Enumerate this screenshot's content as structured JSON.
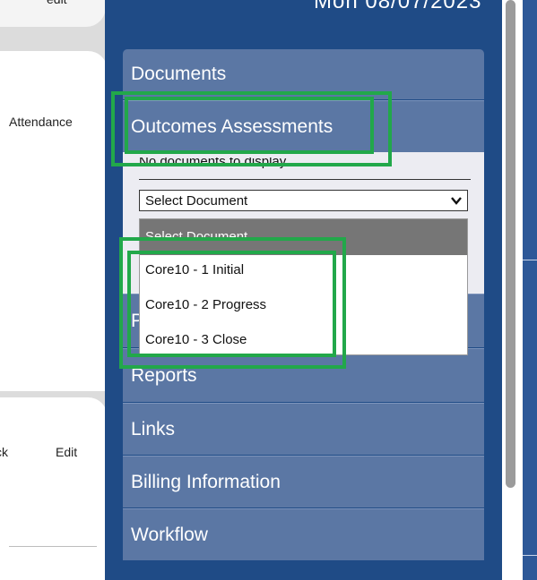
{
  "left": {
    "top_card_label": "edit",
    "attendance_label": "Attendance",
    "bottom_left_label": "ck",
    "bottom_edit_label": "Edit"
  },
  "header": {
    "date": "Mon 08/07/2023"
  },
  "menu": {
    "documents": "Documents",
    "outcomes": "Outcomes Assessments",
    "partially_hidden": "P",
    "reports": "Reports",
    "links": "Links",
    "billing": "Billing Information",
    "workflow": "Workflow"
  },
  "dropdown": {
    "no_docs": "No documents to display",
    "selected": "Select Document",
    "options": [
      "Select Document",
      "Core10 - 1 Initial",
      "Core10 - 2 Progress",
      "Core10 - 3 Close"
    ]
  },
  "colors": {
    "highlight": "#22a84a",
    "panel": "#1f4b86",
    "menu_item": "#5b77a4"
  },
  "icons": {
    "select_arrow": "chevron-down-icon"
  }
}
